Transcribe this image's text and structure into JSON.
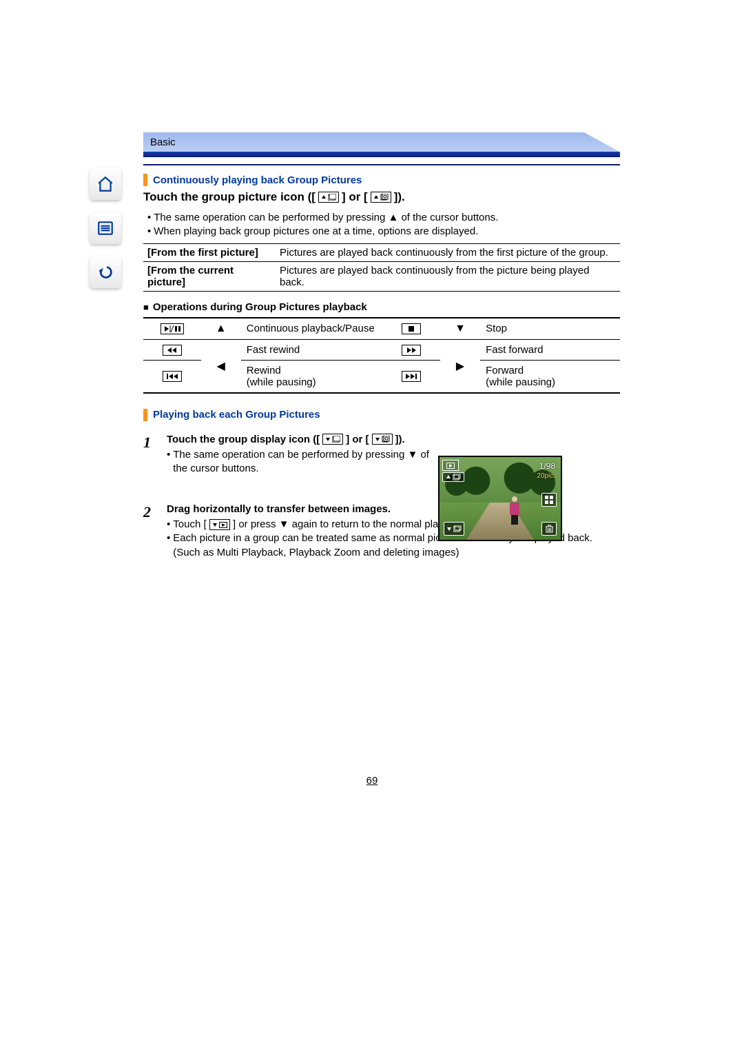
{
  "header": {
    "section": "Basic"
  },
  "section1": {
    "heading": "Continuously playing back Group Pictures",
    "touch_pre": "Touch the group picture icon ([",
    "touch_mid": "] or [",
    "touch_post": "]).",
    "bullet1": "The same operation can be performed by pressing ▲ of the cursor buttons.",
    "bullet2": "When playing back group pictures one at a time, options are displayed.",
    "def": [
      {
        "key": "[From the first picture]",
        "val": "Pictures are played back continuously from the first picture of the group."
      },
      {
        "key": "[From the current picture]",
        "val": "Pictures are played back continuously from the picture being played back."
      }
    ],
    "ops_heading": "Operations during Group Pictures playback",
    "ops": {
      "up": "▲",
      "down": "▼",
      "left": "◀",
      "right": "▶",
      "play_pause": "Continuous playback/Pause",
      "stop": "Stop",
      "fast_rewind": "Fast rewind",
      "fast_forward": "Fast forward",
      "rewind_pause": "Rewind\n(while pausing)",
      "forward_pause": "Forward\n(while pausing)"
    }
  },
  "section2": {
    "heading": "Playing back each Group Pictures",
    "step1": {
      "title_pre": "Touch the group display icon ([",
      "title_mid": "] or [",
      "title_post": "]).",
      "bullet1": "The same operation can be performed by pressing ▼ of the cursor buttons."
    },
    "step2": {
      "title": "Drag horizontally to transfer between images.",
      "bullet1_pre": "Touch [",
      "bullet1_post": "] or press ▼ again to return to the normal playback screen.",
      "bullet2": "Each picture in a group can be treated same as normal pictures when they are played back. (Such as Multi Playback, Playback Zoom and deleting images)"
    }
  },
  "camera": {
    "counter": "1/98",
    "piccount": "20pic."
  },
  "page_number": "69"
}
